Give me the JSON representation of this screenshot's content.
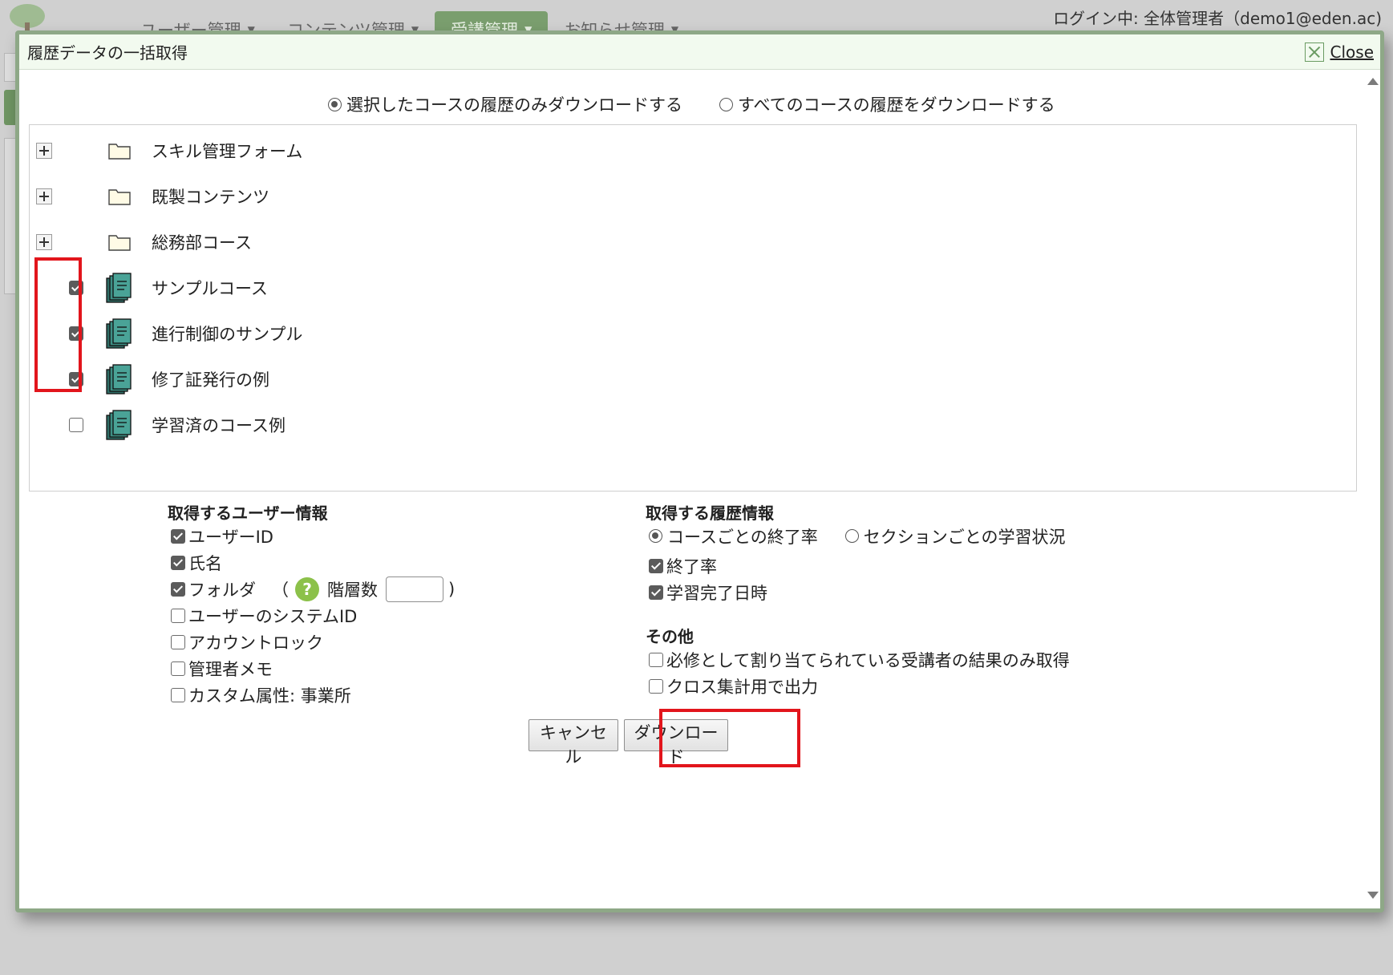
{
  "background": {
    "nav": [
      {
        "label": "ユーザー管理",
        "active": false
      },
      {
        "label": "コンテンツ管理",
        "active": false
      },
      {
        "label": "受講管理",
        "active": true
      },
      {
        "label": "お知らせ管理",
        "active": false
      }
    ],
    "login_text": "ログイン中: 全体管理者（demo1@eden.ac)"
  },
  "modal": {
    "title": "履歴データの一括取得",
    "close_label": "Close",
    "scope_options": [
      {
        "label": "選択したコースの履歴のみダウンロードする",
        "selected": true
      },
      {
        "label": "すべてのコースの履歴をダウンロードする",
        "selected": false
      }
    ],
    "tree": {
      "folders": [
        {
          "label": "スキル管理フォーム"
        },
        {
          "label": "既製コンテンツ"
        },
        {
          "label": "総務部コース"
        }
      ],
      "courses": [
        {
          "label": "サンプルコース",
          "checked": true
        },
        {
          "label": "進行制御のサンプル",
          "checked": true
        },
        {
          "label": "修了証発行の例",
          "checked": true
        },
        {
          "label": "学習済のコース例",
          "checked": false
        }
      ]
    },
    "user_info": {
      "title": "取得するユーザー情報",
      "items": [
        {
          "label": "ユーザーID",
          "checked": true
        },
        {
          "label": "氏名",
          "checked": true
        },
        {
          "label": "フォルダ",
          "checked": true
        },
        {
          "label": "ユーザーのシステムID",
          "checked": false
        },
        {
          "label": "アカウントロック",
          "checked": false
        },
        {
          "label": "管理者メモ",
          "checked": false
        },
        {
          "label": "カスタム属性: 事業所",
          "checked": false
        }
      ],
      "folder_open_paren": "（",
      "level_label": "階層数",
      "level_value": "",
      "folder_close_paren": ")"
    },
    "history_info": {
      "title": "取得する履歴情報",
      "mode_options": [
        {
          "label": "コースごとの終了率",
          "selected": true
        },
        {
          "label": "セクションごとの学習状況",
          "selected": false
        }
      ],
      "items": [
        {
          "label": "終了率",
          "checked": true
        },
        {
          "label": "学習完了日時",
          "checked": true
        }
      ]
    },
    "other": {
      "title": "その他",
      "items": [
        {
          "label": "必修として割り当てられている受講者の結果のみ取得",
          "checked": false
        },
        {
          "label": "クロス集計用で出力",
          "checked": false
        }
      ]
    },
    "buttons": {
      "cancel": "キャンセル",
      "download": "ダウンロード"
    }
  },
  "colors": {
    "highlight": "#e2151c",
    "modal_border": "#8ea887",
    "active_tab": "#7a9e6e",
    "help_icon": "#8cc14a",
    "course_icon": "#3e8f84"
  }
}
